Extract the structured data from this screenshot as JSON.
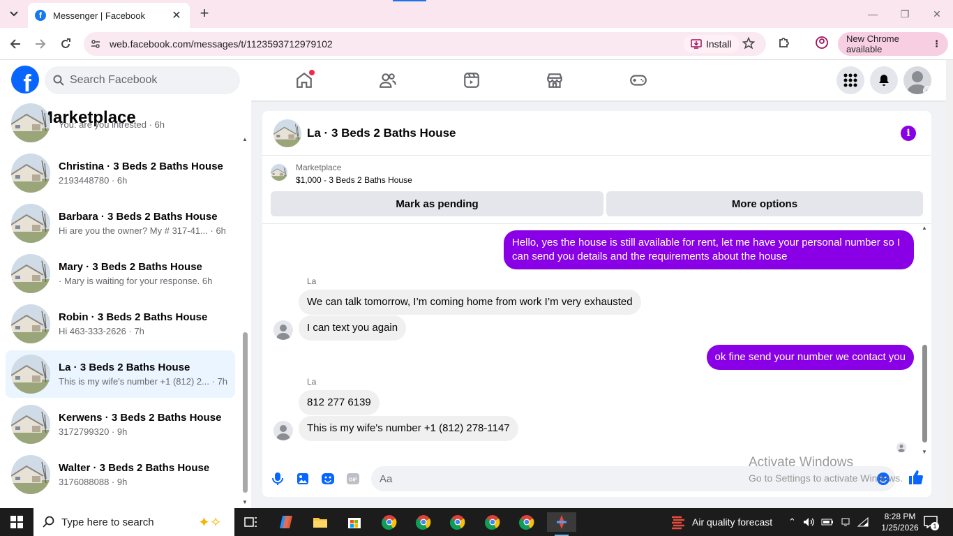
{
  "browser": {
    "tab_title": "Messenger | Facebook",
    "url": "web.facebook.com/messages/t/1123593712979102",
    "install_label": "Install",
    "new_chrome_label": "New Chrome available"
  },
  "fb": {
    "logo_letter": "f",
    "search_placeholder": "Search Facebook"
  },
  "marketplace": {
    "title": "Marketplace",
    "conversations": [
      {
        "name": "",
        "preview": "You: are you intrested · 6h",
        "active": false
      },
      {
        "name": "Christina · 3 Beds 2 Baths House",
        "preview": "2193448780 · 6h",
        "active": false
      },
      {
        "name": "Barbara · 3 Beds 2 Baths House",
        "preview": "Hi are you the owner? My # 317-41... · 6h",
        "active": false
      },
      {
        "name": "Mary · 3 Beds 2 Baths House",
        "preview": "· Mary is waiting for your response. 6h",
        "active": false
      },
      {
        "name": "Robin · 3 Beds 2 Baths House",
        "preview": "Hi 463-333-2626 · 7h",
        "active": false
      },
      {
        "name": "La · 3 Beds 2 Baths House",
        "preview": "This is my wife's number +1 (812) 2... · 7h",
        "active": true
      },
      {
        "name": "Kerwens · 3 Beds 2 Baths House",
        "preview": "3172799320 · 9h",
        "active": false
      },
      {
        "name": "Walter · 3 Beds 2 Baths House",
        "preview": "3176088088 · 9h",
        "active": false
      }
    ]
  },
  "chat": {
    "title": "La · 3 Beds 2 Baths House",
    "listing_label": "Marketplace",
    "listing_price": "$1,000 - 3 Beds 2 Baths House",
    "mark_pending_label": "Mark as pending",
    "more_options_label": "More options",
    "messages": [
      {
        "from": "me",
        "text": "Hello, yes the house is still available for rent, let me have your personal number so I can send you details and the requirements about the house"
      },
      {
        "from": "La",
        "sender_label": "La",
        "text": "We can talk tomorrow, I’m coming home from work I’m very exhausted"
      },
      {
        "from": "La",
        "text": "I can text you again"
      },
      {
        "from": "me",
        "text": "ok fine send your number we contact you"
      },
      {
        "from": "La",
        "sender_label": "La",
        "text": "812 277 6139"
      },
      {
        "from": "La",
        "text": "This is my wife's number +1 (812) 278-1147"
      }
    ],
    "input_placeholder": "Aa"
  },
  "watermark": {
    "line1": "Activate Windows",
    "line2": "Go to Settings to activate Windows."
  },
  "taskbar": {
    "search_placeholder": "Type here to search",
    "weather": "Air quality forecast",
    "time": "8:28 PM",
    "date": "1/25/2026",
    "notification_count": "1"
  },
  "colors": {
    "accent_purple": "#8a00e6",
    "facebook_blue": "#0866ff",
    "active_conversation_bg": "#ebf5ff"
  }
}
